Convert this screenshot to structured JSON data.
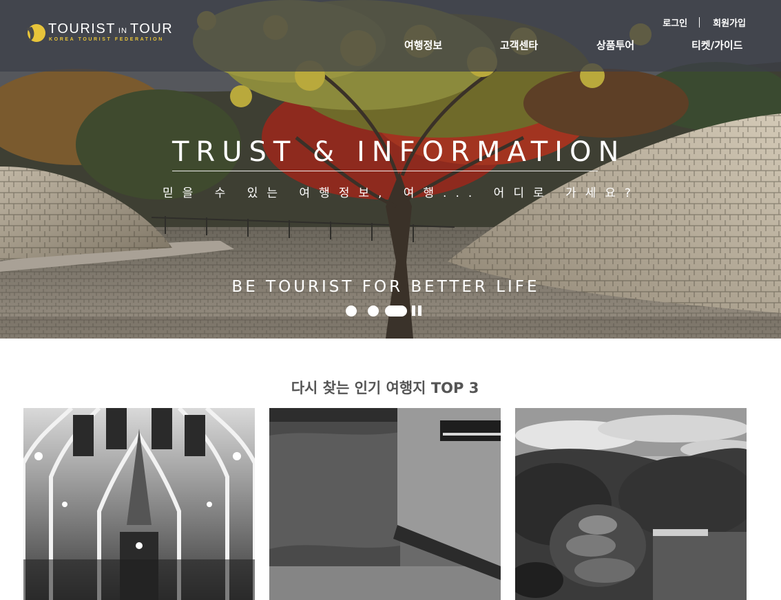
{
  "brand": {
    "name_left": "TOURIST",
    "name_mid": "IN",
    "name_right": "TOUR",
    "tagline": "KOREA TOURIST FEDERATION",
    "accent_color": "#e7c43a"
  },
  "util_nav": {
    "login": "로그인",
    "signup": "회원가입"
  },
  "main_nav": [
    "여행정보",
    "고객센타",
    "상품투어",
    "티켓/가이드"
  ],
  "hero": {
    "title": "TRUST & INFORMATION",
    "subtitle": "믿을 수 있는 여행정보, 여행... 어디로 가세요?",
    "tagline": "BE TOURIST FOR BETTER LIFE",
    "slide_count": 3,
    "active_slide": 3,
    "pause_icon": "pause-icon"
  },
  "top3": {
    "title_prefix": "다시 찾는 인기 여행지",
    "title_bold": "TOP 3",
    "cards": [
      {
        "icon": "cathedral-photo"
      },
      {
        "icon": "reflecting-pool-photo"
      },
      {
        "icon": "japanese-garden-photo"
      }
    ]
  }
}
